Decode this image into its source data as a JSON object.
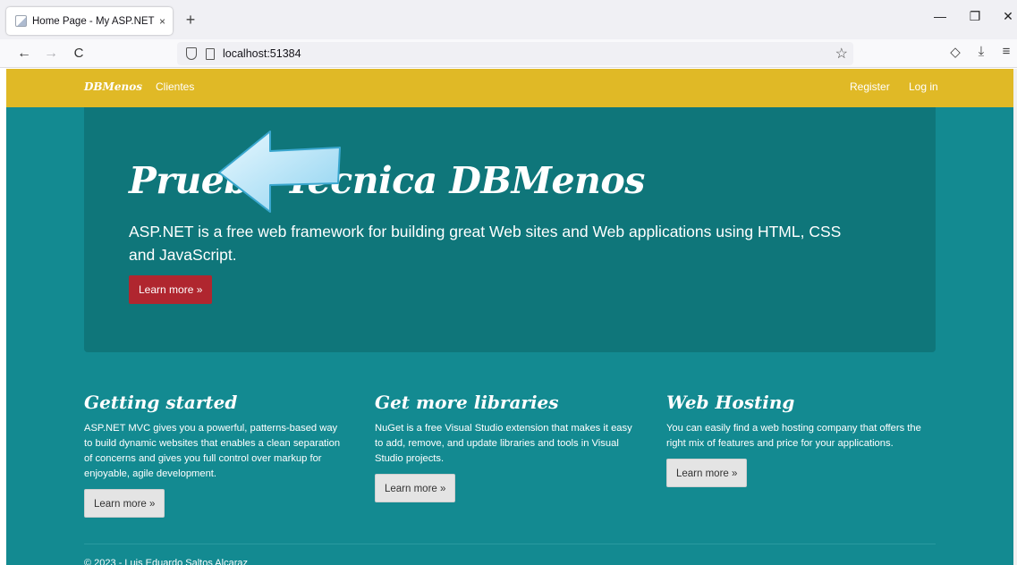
{
  "browser": {
    "tab_title": "Home Page - My ASP.NET Appl",
    "tab_close": "×",
    "new_tab": "+",
    "url": "localhost:51384",
    "window_controls": {
      "minimize": "—",
      "restore": "❐",
      "close": "✕"
    },
    "nav_icons": {
      "back": "←",
      "forward": "→",
      "reload": "C"
    },
    "icons": {
      "star": "☆",
      "pocket": "◇",
      "download": "⤓",
      "menu": "≡"
    }
  },
  "site": {
    "brand": "DBMenos",
    "nav_left": [
      "Clientes"
    ],
    "nav_right": {
      "register": "Register",
      "login": "Log in"
    },
    "jumbotron": {
      "title": "Prueba Técnica DBMenos",
      "lead": "ASP.NET is a free web framework for building great Web sites and Web applications using HTML, CSS and JavaScript.",
      "button": "Learn more »"
    },
    "columns": [
      {
        "heading": "Getting started",
        "text": "ASP.NET MVC gives you a powerful, patterns-based way to build dynamic websites that enables a clean separation of concerns and gives you full control over markup for enjoyable, agile development.",
        "button": "Learn more »"
      },
      {
        "heading": "Get more libraries",
        "text": "NuGet is a free Visual Studio extension that makes it easy to add, remove, and update libraries and tools in Visual Studio projects.",
        "button": "Learn more »"
      },
      {
        "heading": "Web Hosting",
        "text": "You can easily find a web hosting company that offers the right mix of features and price for your applications.",
        "button": "Learn more »"
      }
    ],
    "footer": "© 2023 - Luis Eduardo Saltos Alcaraz"
  },
  "colors": {
    "nav_bar": "#e0b926",
    "body": "#138a91",
    "jumbotron": "#0f767a",
    "primary_button": "#b0262f",
    "arrow": "#bfe9fb"
  }
}
